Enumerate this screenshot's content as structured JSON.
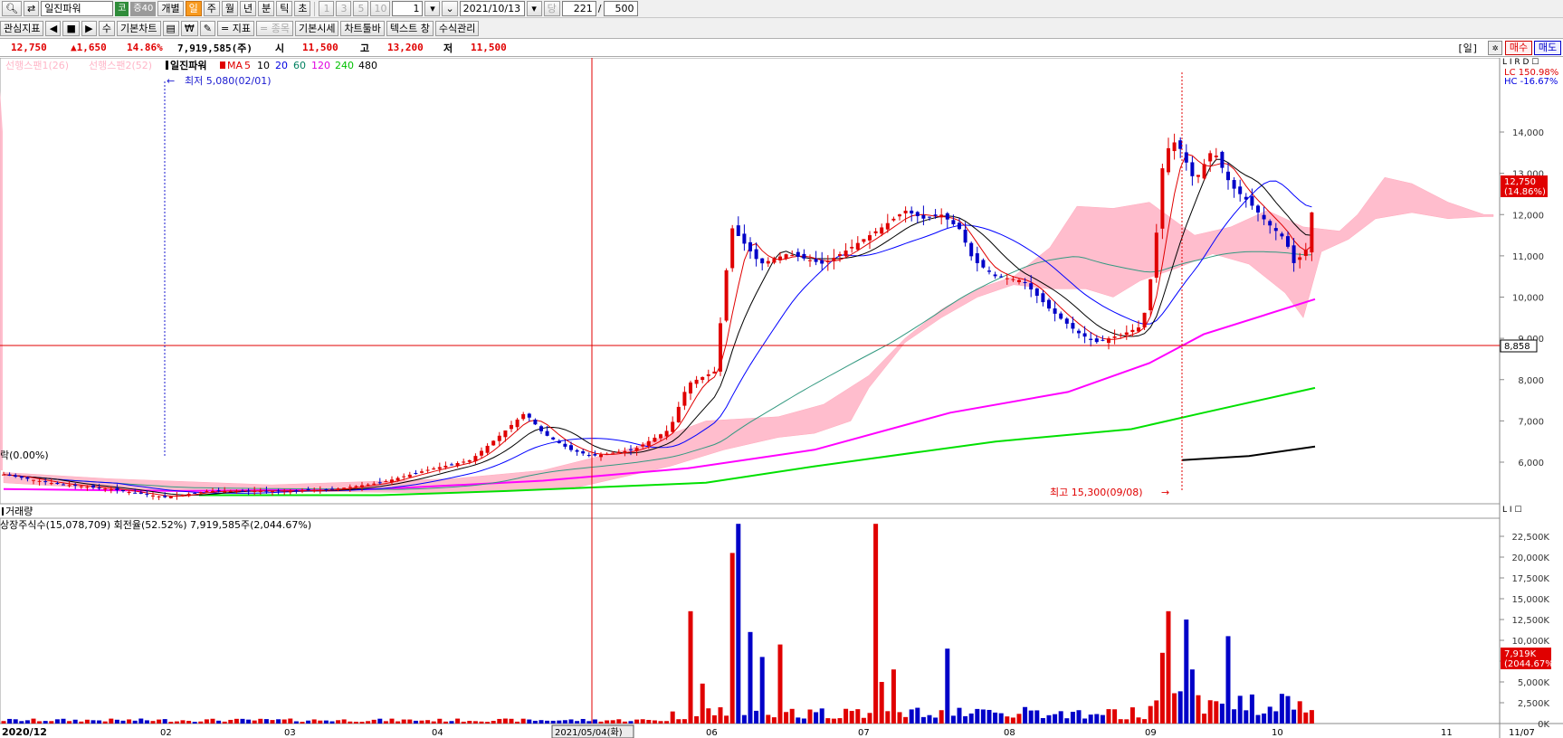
{
  "toolbar": {
    "search_icon": "search-icon",
    "swap_icon": "swap-icon",
    "stock_name": "일진파워",
    "market_badge": "코",
    "margin_badge": "증40",
    "individual": "개별",
    "periods": [
      "일",
      "주",
      "월",
      "년",
      "분",
      "틱",
      "초"
    ],
    "active_period": "일",
    "period_numbers": [
      "1",
      "3",
      "5",
      "10"
    ],
    "multiplier_value": "1",
    "date": "2021/10/13",
    "date_suffix": "당",
    "count_value": "221",
    "count_sep": "/",
    "count_total": "500"
  },
  "toolbar2": {
    "interest_indicator": "관심지표",
    "nav_buttons": [
      "◀",
      "■",
      "▶"
    ],
    "modify": "수",
    "basic_chart": "기본차트",
    "indicator": "= 지표",
    "stock_item": "= 종목",
    "basic_quote": "기본시세",
    "chart_toolbar": "차트툴바",
    "text_window": "텍스트 창",
    "formula_mgmt": "수식관리"
  },
  "infobar": {
    "price": "12,750",
    "change": "▲1,650",
    "change_pct": "14.86%",
    "volume": "7,919,585(주)",
    "open_label": "시",
    "open": "11,500",
    "high_label": "고",
    "high": "13,200",
    "low_label": "저",
    "low": "11,500",
    "period_badge": "[일]",
    "buy_button": "매수",
    "sell_button": "매도"
  },
  "price_chart": {
    "legend_cloud1": "선행스팬1(26)",
    "legend_cloud2": "선행스팬2(52)",
    "stock_label": "일진파워",
    "ma_label": "MA",
    "ma_periods": [
      {
        "label": "5",
        "color": "#e00000"
      },
      {
        "label": "10",
        "color": "#000000"
      },
      {
        "label": "20",
        "color": "#0000e0"
      },
      {
        "label": "60",
        "color": "#008060"
      },
      {
        "label": "120",
        "color": "#e000e0"
      },
      {
        "label": "240",
        "color": "#00c000"
      },
      {
        "label": "480",
        "color": "#000000"
      }
    ],
    "low_annotation": "최저 5,080(02/01)",
    "high_annotation": "최고 15,300(09/08)",
    "left_label": "락(0.00%)",
    "lc_label": "LC 150.98%",
    "hc_label": "HC -16.67%",
    "current_price_tag": "12,750",
    "current_pct_tag": "(14.86%)",
    "cursor_price_tag": "8,858",
    "y_ticks": [
      "14,000",
      "13,000",
      "12,000",
      "11,000",
      "10,000",
      "9,000",
      "8,000",
      "7,000",
      "6,000"
    ]
  },
  "volume_chart": {
    "title": "거래량",
    "info": "상장주식수(15,078,709) 회전율(52.52%) 7,919,585주(2,044.67%)",
    "y_ticks": [
      "22,500K",
      "20,000K",
      "17,500K",
      "15,000K",
      "12,500K",
      "10,000K",
      "7,500K",
      "5,000K",
      "2,500K",
      "0K"
    ],
    "current_tag": "7,919K",
    "current_pct_tag": "(2044.67%)"
  },
  "x_axis": {
    "labels": [
      "2020/12",
      "02",
      "03",
      "04",
      "06",
      "07",
      "08",
      "09",
      "10",
      "11"
    ],
    "cursor_date": "2021/05/04(화)",
    "right_date": "11/07"
  },
  "colors": {
    "up": "#e00000",
    "down": "#0000c8",
    "cloud": "#ffb6c8",
    "cursor": "#e00000"
  },
  "chart_data": {
    "type": "candlestick",
    "ylim": [
      5000,
      15500
    ],
    "price_series": [
      {
        "date": "2020/12",
        "close": 5700
      },
      {
        "date": "02",
        "close": 5150
      },
      {
        "date": "03",
        "close": 5300
      },
      {
        "date": "04",
        "close": 5500
      },
      {
        "date": "2021/05/04",
        "close": 6500
      },
      {
        "date": "06",
        "close": 10900
      },
      {
        "date": "07",
        "close": 12000
      },
      {
        "date": "08",
        "close": 9000
      },
      {
        "date": "09",
        "close": 13800
      },
      {
        "date": "10",
        "close": 11100
      },
      {
        "date": "2021/10/13",
        "close": 12750
      }
    ],
    "volume_last": 7919585
  }
}
